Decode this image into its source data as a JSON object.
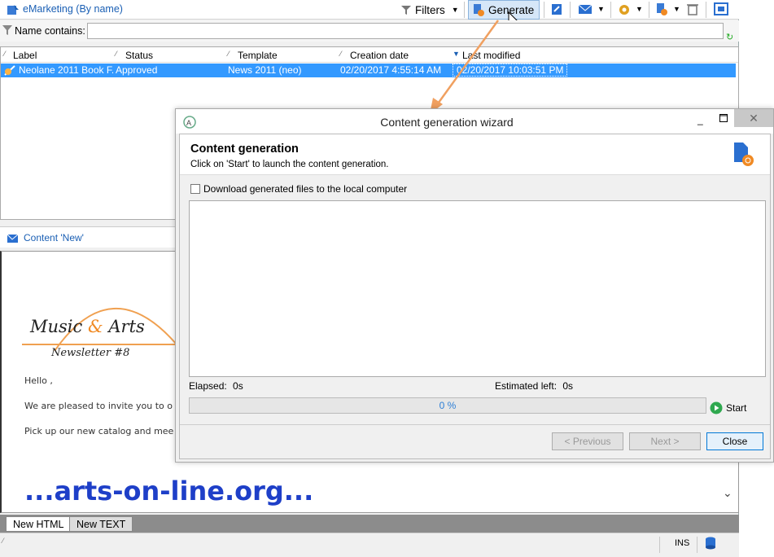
{
  "app": {
    "title": "eMarketing (By name)",
    "toolbar": {
      "filters_label": "Filters",
      "generate_label": "Generate"
    }
  },
  "filter": {
    "name_contains_label": "Name contains:",
    "name_value": ""
  },
  "list": {
    "columns": [
      "Label",
      "Status",
      "Template",
      "Creation date",
      "Last modified"
    ],
    "rows": [
      {
        "label": "Neolane 2011 Book F...",
        "status": "Approved",
        "template": "News 2011 (neo)",
        "created": "02/20/2017 4:55:14 AM",
        "modified": "02/20/2017 10:03:51 PM"
      }
    ]
  },
  "content": {
    "title": "Content 'New'",
    "newsletter": {
      "brand_left": "Music",
      "brand_amp": "&",
      "brand_right": "Arts",
      "issue": "Newsletter #8",
      "greeting": "Hello ,",
      "line1": "We are pleased to invite you to o",
      "line2": "Pick up our new catalog and mee"
    },
    "watermark": "...arts-on-line.org...",
    "tabs": [
      "New HTML",
      "New TEXT"
    ]
  },
  "status": {
    "ins": "INS"
  },
  "wizard": {
    "title": "Content generation wizard",
    "heading": "Content generation",
    "subtitle": "Click on 'Start' to launch the content generation.",
    "download_label": "Download generated files to the local computer",
    "download_checked": false,
    "elapsed_label": "Elapsed:",
    "elapsed_value": "0s",
    "estimated_label": "Estimated left:",
    "estimated_value": "0s",
    "progress_percent": 0,
    "progress_text": "0 %",
    "start_label": "Start",
    "prev_label": "< Previous",
    "next_label": "Next >",
    "close_label": "Close"
  },
  "colors": {
    "accent": "#3399ff",
    "link": "#1a5fb4",
    "arrow": "#f0a060",
    "watermark": "#1e3fc8"
  }
}
